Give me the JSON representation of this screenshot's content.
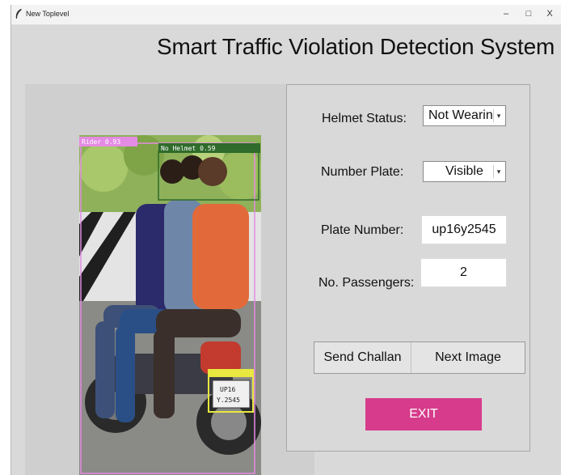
{
  "window": {
    "title": "New Toplevel",
    "controls": {
      "minimize": "–",
      "maximize": "□",
      "close": "X"
    }
  },
  "app": {
    "heading": "Smart Traffic Violation Detection System"
  },
  "detections": [
    {
      "label": "Rider 0.93",
      "color": "#e48be4"
    },
    {
      "label": "No Helmet 0.59",
      "color": "#2f6b2a"
    }
  ],
  "plate_on_image": {
    "line1": "UP16",
    "line2": "Y.2545"
  },
  "form": {
    "helmet_status": {
      "label": "Helmet Status:",
      "value": "Not Wearing"
    },
    "number_plate": {
      "label": "Number Plate:",
      "value": "Visible"
    },
    "plate_number": {
      "label": "Plate Number:",
      "value": "up16y2545"
    },
    "passengers": {
      "label": "No. Passengers:",
      "value": "2"
    }
  },
  "buttons": {
    "send_challan": "Send Challan",
    "next_image": "Next Image",
    "exit": "EXIT"
  },
  "colors": {
    "window_bg": "#d9d9d9",
    "exit_bg": "#d63c8b",
    "exit_text": "#ffffff"
  }
}
